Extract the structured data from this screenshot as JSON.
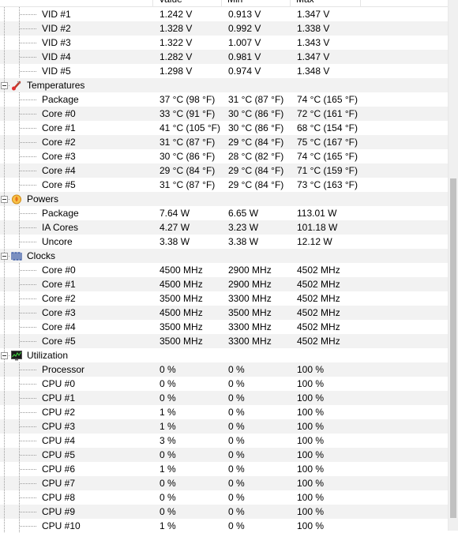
{
  "columns": {
    "sensor": "",
    "value": "Value",
    "min": "Min",
    "max": "Max"
  },
  "groups": {
    "voltages": {
      "rows": [
        {
          "label": "VID #1",
          "value": "1.242 V",
          "min": "0.913 V",
          "max": "1.347 V"
        },
        {
          "label": "VID #2",
          "value": "1.328 V",
          "min": "0.992 V",
          "max": "1.338 V"
        },
        {
          "label": "VID #3",
          "value": "1.322 V",
          "min": "1.007 V",
          "max": "1.343 V"
        },
        {
          "label": "VID #4",
          "value": "1.282 V",
          "min": "0.981 V",
          "max": "1.347 V"
        },
        {
          "label": "VID #5",
          "value": "1.298 V",
          "min": "0.974 V",
          "max": "1.348 V"
        }
      ]
    },
    "temperatures": {
      "label": "Temperatures",
      "icon": "thermometer-icon",
      "rows": [
        {
          "label": "Package",
          "value": "37 °C  (98 °F)",
          "min": "31 °C  (87 °F)",
          "max": "74 °C  (165 °F)"
        },
        {
          "label": "Core #0",
          "value": "33 °C  (91 °F)",
          "min": "30 °C  (86 °F)",
          "max": "72 °C  (161 °F)"
        },
        {
          "label": "Core #1",
          "value": "41 °C  (105 °F)",
          "min": "30 °C  (86 °F)",
          "max": "68 °C  (154 °F)"
        },
        {
          "label": "Core #2",
          "value": "31 °C  (87 °F)",
          "min": "29 °C  (84 °F)",
          "max": "75 °C  (167 °F)"
        },
        {
          "label": "Core #3",
          "value": "30 °C  (86 °F)",
          "min": "28 °C  (82 °F)",
          "max": "74 °C  (165 °F)"
        },
        {
          "label": "Core #4",
          "value": "29 °C  (84 °F)",
          "min": "29 °C  (84 °F)",
          "max": "71 °C  (159 °F)"
        },
        {
          "label": "Core #5",
          "value": "31 °C  (87 °F)",
          "min": "29 °C  (84 °F)",
          "max": "73 °C  (163 °F)"
        }
      ]
    },
    "powers": {
      "label": "Powers",
      "icon": "flame-icon",
      "rows": [
        {
          "label": "Package",
          "value": "7.64 W",
          "min": "6.65 W",
          "max": "113.01 W"
        },
        {
          "label": "IA Cores",
          "value": "4.27 W",
          "min": "3.23 W",
          "max": "101.18 W"
        },
        {
          "label": "Uncore",
          "value": "3.38 W",
          "min": "3.38 W",
          "max": "12.12 W"
        }
      ]
    },
    "clocks": {
      "label": "Clocks",
      "icon": "clock-wave-icon",
      "rows": [
        {
          "label": "Core #0",
          "value": "4500 MHz",
          "min": "2900 MHz",
          "max": "4502 MHz"
        },
        {
          "label": "Core #1",
          "value": "4500 MHz",
          "min": "2900 MHz",
          "max": "4502 MHz"
        },
        {
          "label": "Core #2",
          "value": "3500 MHz",
          "min": "3300 MHz",
          "max": "4502 MHz"
        },
        {
          "label": "Core #3",
          "value": "4500 MHz",
          "min": "3500 MHz",
          "max": "4502 MHz"
        },
        {
          "label": "Core #4",
          "value": "3500 MHz",
          "min": "3300 MHz",
          "max": "4502 MHz"
        },
        {
          "label": "Core #5",
          "value": "3500 MHz",
          "min": "3300 MHz",
          "max": "4502 MHz"
        }
      ]
    },
    "utilization": {
      "label": "Utilization",
      "icon": "monitor-graph-icon",
      "rows": [
        {
          "label": "Processor",
          "value": "0 %",
          "min": "0 %",
          "max": "100 %"
        },
        {
          "label": "CPU #0",
          "value": "0 %",
          "min": "0 %",
          "max": "100 %"
        },
        {
          "label": "CPU #1",
          "value": "0 %",
          "min": "0 %",
          "max": "100 %"
        },
        {
          "label": "CPU #2",
          "value": "1 %",
          "min": "0 %",
          "max": "100 %"
        },
        {
          "label": "CPU #3",
          "value": "1 %",
          "min": "0 %",
          "max": "100 %"
        },
        {
          "label": "CPU #4",
          "value": "3 %",
          "min": "0 %",
          "max": "100 %"
        },
        {
          "label": "CPU #5",
          "value": "0 %",
          "min": "0 %",
          "max": "100 %"
        },
        {
          "label": "CPU #6",
          "value": "1 %",
          "min": "0 %",
          "max": "100 %"
        },
        {
          "label": "CPU #7",
          "value": "0 %",
          "min": "0 %",
          "max": "100 %"
        },
        {
          "label": "CPU #8",
          "value": "0 %",
          "min": "0 %",
          "max": "100 %"
        },
        {
          "label": "CPU #9",
          "value": "0 %",
          "min": "0 %",
          "max": "100 %"
        },
        {
          "label": "CPU #10",
          "value": "1 %",
          "min": "0 %",
          "max": "100 %"
        }
      ]
    }
  },
  "colors": {
    "alt_row": "#f2f2f2",
    "tree_lines": "#9a9a9a",
    "scrollbar_thumb": "#c1c1c1"
  }
}
